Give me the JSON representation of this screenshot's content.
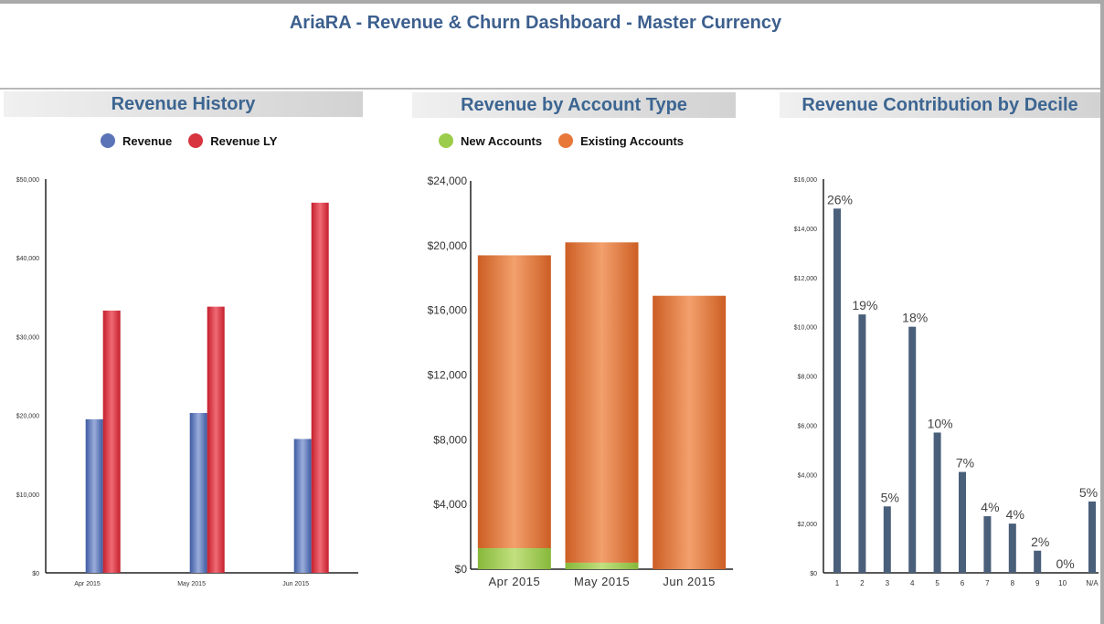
{
  "dashboard": {
    "title": "AriaRA - Revenue & Churn Dashboard - Master Currency"
  },
  "colors": {
    "revenue": "#5b74b8",
    "revenue_ly": "#d7343f",
    "new_accounts": "#9ccc4b",
    "existing_accounts": "#e8783a",
    "decile": "#4a5f7a",
    "header_text": "#3c6591"
  },
  "chart_data": [
    {
      "type": "bar",
      "title": "Revenue History",
      "categories": [
        "Apr 2015",
        "May 2015",
        "Jun 2015"
      ],
      "series": [
        {
          "name": "Revenue",
          "values": [
            19500,
            20300,
            17000
          ]
        },
        {
          "name": "Revenue LY",
          "values": [
            33300,
            33800,
            47000
          ]
        }
      ],
      "ylim": [
        0,
        50000
      ],
      "yticks": [
        "$0",
        "$10,000",
        "$20,000",
        "$30,000",
        "$40,000",
        "$50,000"
      ],
      "legend": "top-center",
      "grid": false
    },
    {
      "type": "bar",
      "stacked": true,
      "title": "Revenue by Account Type",
      "categories": [
        "Apr 2015",
        "May 2015",
        "Jun 2015"
      ],
      "series": [
        {
          "name": "New Accounts",
          "values": [
            1300,
            400,
            0
          ]
        },
        {
          "name": "Existing Accounts",
          "values": [
            18100,
            19800,
            16900
          ]
        }
      ],
      "ylim": [
        0,
        24000
      ],
      "yticks": [
        "$0",
        "$4,000",
        "$8,000",
        "$12,000",
        "$16,000",
        "$20,000",
        "$24,000"
      ],
      "legend": "top-center",
      "grid": false
    },
    {
      "type": "bar",
      "title": "Revenue Contribution by Decile",
      "categories": [
        "1",
        "2",
        "3",
        "4",
        "5",
        "6",
        "7",
        "8",
        "9",
        "10",
        "N/A"
      ],
      "values": [
        14800,
        10500,
        2700,
        10000,
        5700,
        4100,
        2300,
        2000,
        900,
        0,
        2900
      ],
      "data_labels": [
        "26%",
        "19%",
        "5%",
        "18%",
        "10%",
        "7%",
        "4%",
        "4%",
        "2%",
        "0%",
        "5%"
      ],
      "ylim": [
        0,
        16000
      ],
      "yticks": [
        "$0",
        "$2,000",
        "$4,000",
        "$6,000",
        "$8,000",
        "$10,000",
        "$12,000",
        "$14,000",
        "$16,000"
      ],
      "grid": false
    }
  ]
}
